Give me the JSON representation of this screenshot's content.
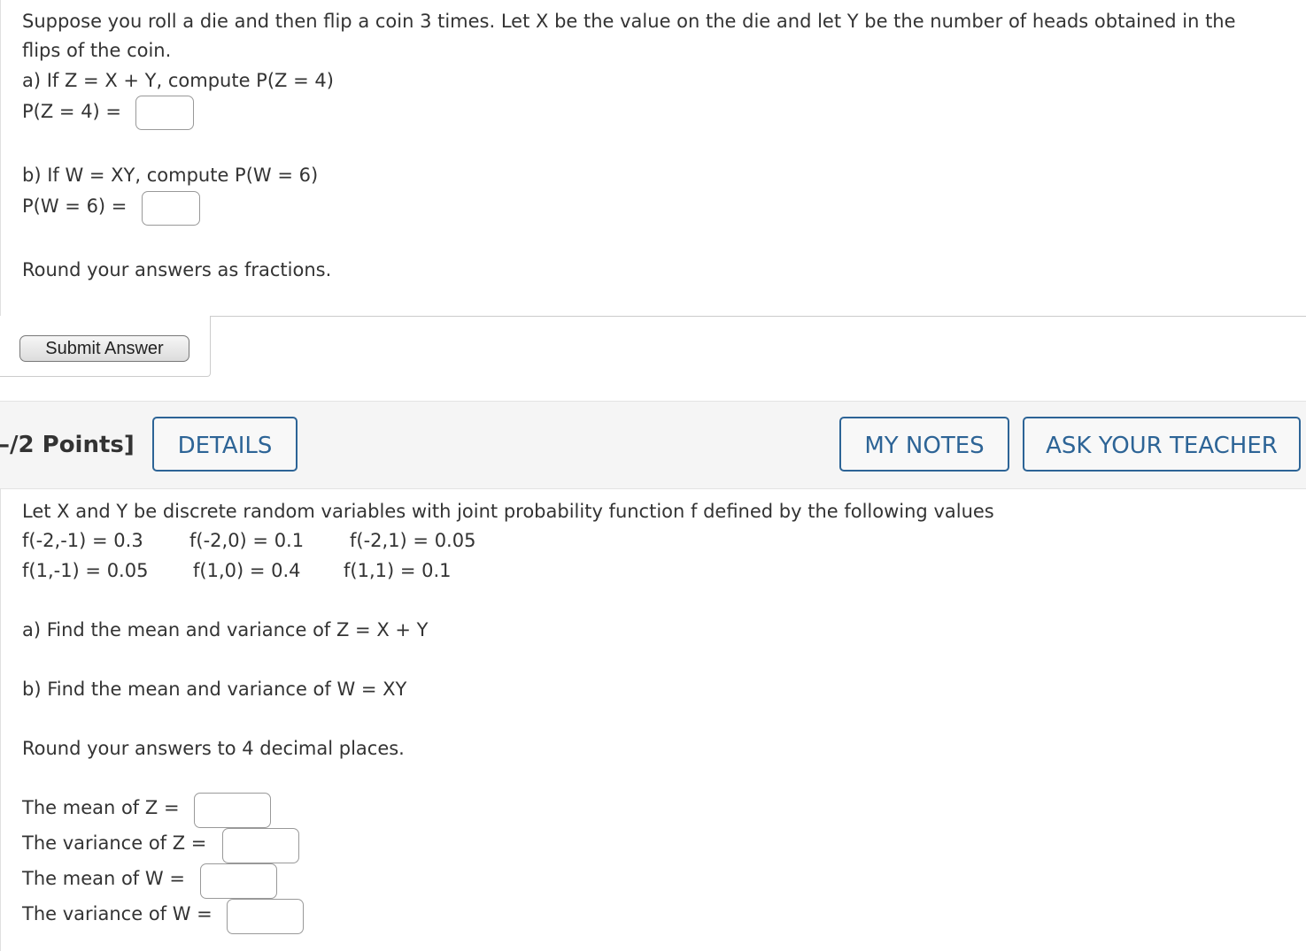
{
  "question1": {
    "intro_line1": "Suppose you roll a die and then flip a coin 3 times. Let X be the value on the die and let Y be the number of heads obtained in the",
    "intro_line2": "flips of the coin.",
    "part_a": "a) If Z = X + Y, compute P(Z = 4)",
    "part_a_label": "P(Z = 4) =",
    "part_a_value": "",
    "part_b": "b) If W = XY, compute P(W = 6)",
    "part_b_label": "P(W = 6) =",
    "part_b_value": "",
    "instruction": "Round your answers as fractions.",
    "submit_label": "Submit Answer"
  },
  "header": {
    "points": "–/2 Points]",
    "details_label": "DETAILS",
    "my_notes_label": "MY NOTES",
    "ask_teacher_label": "ASK YOUR TEACHER"
  },
  "question2": {
    "intro": "Let X and Y be discrete random variables with joint probability function f defined by the following values",
    "row1": [
      "f(-2,-1) = 0.3",
      "f(-2,0) = 0.1",
      "f(-2,1) = 0.05"
    ],
    "row2": [
      "f(1,-1) = 0.05",
      "f(1,0) = 0.4",
      "f(1,1) = 0.1"
    ],
    "part_a": "a) Find the mean and variance of Z = X + Y",
    "part_b": "b) Find the mean and variance of W = XY",
    "instruction": "Round your answers to 4 decimal places.",
    "answers": [
      {
        "label": "The mean of Z =",
        "value": ""
      },
      {
        "label": "The variance of Z =",
        "value": ""
      },
      {
        "label": "The mean of W =",
        "value": ""
      },
      {
        "label": "The variance of W =",
        "value": ""
      }
    ]
  }
}
